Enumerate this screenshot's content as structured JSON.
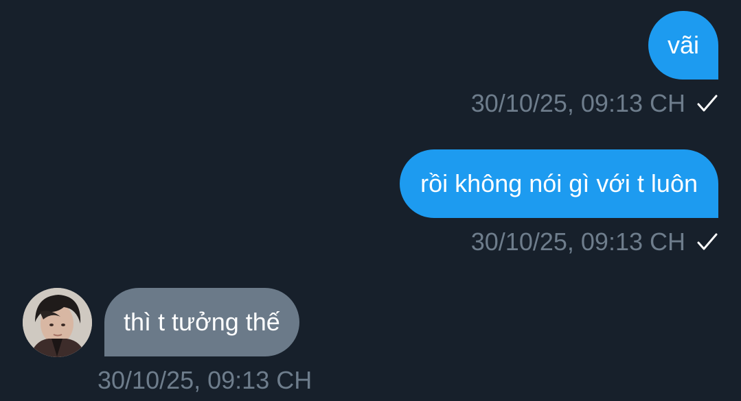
{
  "messages": [
    {
      "text": "vãi",
      "timestamp": "30/10/25, 09:13 CH",
      "direction": "outgoing",
      "status_icon": "check-icon"
    },
    {
      "text": "rồi không nói gì với t luôn",
      "timestamp": "30/10/25, 09:13 CH",
      "direction": "outgoing",
      "status_icon": "check-icon"
    },
    {
      "text": "thì t tưởng thế",
      "timestamp": "30/10/25, 09:13 CH",
      "direction": "incoming",
      "avatar": "avatar-photo"
    }
  ],
  "colors": {
    "background": "#17202b",
    "outgoing_bubble": "#1d9bf0",
    "incoming_bubble": "#6b7a89",
    "timestamp": "#6e7d8c",
    "text": "#ffffff"
  }
}
